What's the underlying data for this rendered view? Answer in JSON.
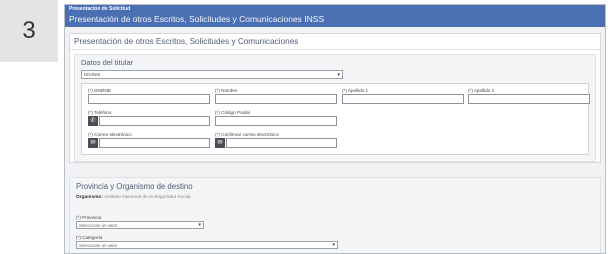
{
  "step_number": "3",
  "banner": {
    "subtitle": "Presentación de Solicitud",
    "title": "Presentación de otros Escritos, Solicitudes y Comunicaciones INSS"
  },
  "form": {
    "heading": "Presentación de otros Escritos, Solicitudes y Comunicaciones",
    "titular": {
      "title": "Datos del titular",
      "type_select": {
        "value": "DNI/NIE",
        "icon": "chevron-down-icon"
      },
      "fields": {
        "dni": "(*) DNI/NIE",
        "nombre": "(*) Nombre",
        "apellido1": "(*) Apellido 1",
        "apellido2": "(*) Apellido 2",
        "telefono": "(*) Teléfono",
        "codigo_postal": "(*) Código Postal",
        "email": "(*) Correo electrónico",
        "email_confirm": "(*) Confirmar correo electrónico"
      },
      "icons": {
        "phone": "phone-icon",
        "email": "mail-icon"
      }
    },
    "provincia": {
      "title": "Provincia y Organismo de destino",
      "organismo_label": "Organismo:",
      "organismo_value": "Instituto Nacional de la Seguridad Social",
      "provincia_label": "(*) Provincia",
      "provincia_placeholder": "Seleccione un valor",
      "categoria_label": "(*) Categoría",
      "categoria_placeholder": "Seleccione un valor"
    }
  },
  "colors": {
    "banner": "#4a6fb2",
    "heading": "#4f5d73"
  }
}
